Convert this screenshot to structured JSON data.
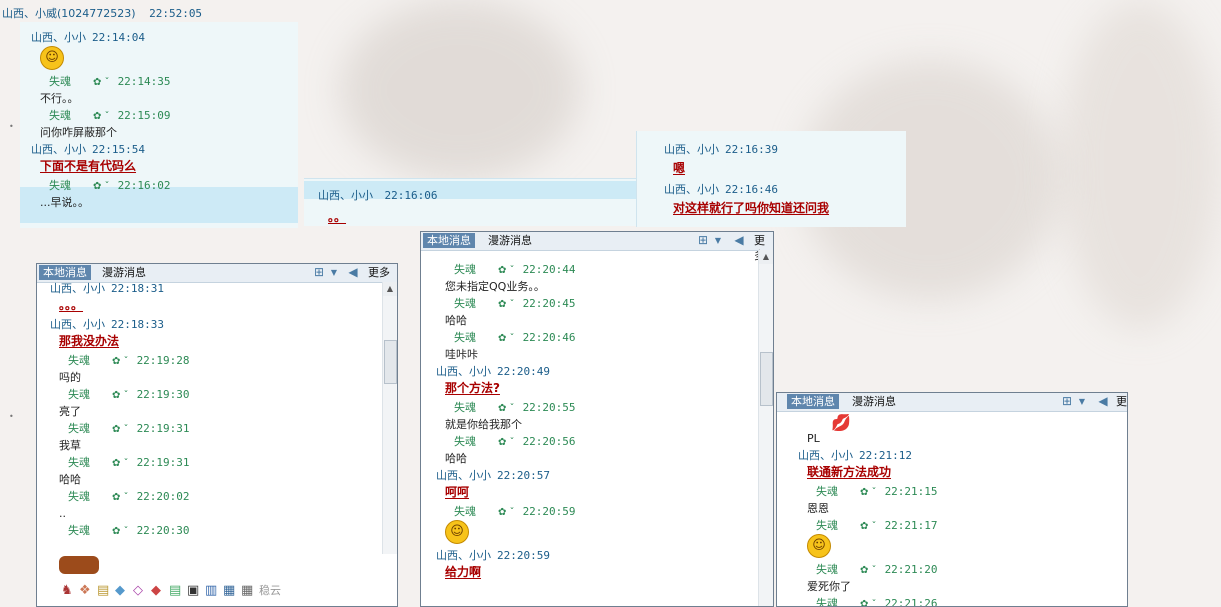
{
  "colors": {
    "name_blue": "#1b5d8a",
    "sender_green": "#2d8a55",
    "bold_red": "#a80000",
    "tab_active": "#5f86ad",
    "highlight": "#cdeaf6",
    "panel_bg": "#eef7f9"
  },
  "top_header": {
    "sender": "山西、小威(1024772523)",
    "time": "22:52:05"
  },
  "chat1": {
    "messages": [
      {
        "kind": "name",
        "text": "山西、小小",
        "time": "22:14:04"
      },
      {
        "kind": "emoji",
        "icon": "grin-emoji"
      },
      {
        "kind": "sender",
        "text": "失魂",
        "time": "22:14:35"
      },
      {
        "kind": "msg",
        "text": "不行。。"
      },
      {
        "kind": "sender",
        "text": "失魂",
        "time": "22:15:09"
      },
      {
        "kind": "msg",
        "text": "问你咋屏蔽那个"
      },
      {
        "kind": "name",
        "text": "山西、小小",
        "time": "22:15:54"
      },
      {
        "kind": "bold",
        "text": "下面不是有代码么"
      },
      {
        "kind": "sender",
        "text": "失魂",
        "time": "22:16:02"
      },
      {
        "kind": "msg",
        "text": "...早说。。"
      }
    ]
  },
  "chat2": {
    "name": "山西、小小",
    "time": "22:16:06",
    "bold": "。。"
  },
  "chat3": {
    "lines": [
      {
        "kind": "name",
        "text": "山西、小小",
        "time": "22:16:39"
      },
      {
        "kind": "bold",
        "text": "嗯"
      },
      {
        "kind": "name",
        "text": "山西、小小",
        "time": "22:16:46"
      },
      {
        "kind": "bold",
        "text": "对这样就行了吗你知道还问我"
      }
    ]
  },
  "window_a": {
    "tab_active": "本地消息",
    "tab": "漫游消息",
    "more": "更多",
    "lines": [
      {
        "kind": "name",
        "text": "山西、小小",
        "time": "22:18:31"
      },
      {
        "kind": "bold",
        "text": "。。。"
      },
      {
        "kind": "name",
        "text": "山西、小小",
        "time": "22:18:33"
      },
      {
        "kind": "bold",
        "text": "那我没办法"
      },
      {
        "kind": "sender",
        "text": "失魂",
        "time": "22:19:28"
      },
      {
        "kind": "msg",
        "text": "吗的"
      },
      {
        "kind": "sender",
        "text": "失魂",
        "time": "22:19:30"
      },
      {
        "kind": "msg",
        "text": "亮了"
      },
      {
        "kind": "sender",
        "text": "失魂",
        "time": "22:19:31"
      },
      {
        "kind": "msg",
        "text": "我草"
      },
      {
        "kind": "sender",
        "text": "失魂",
        "time": "22:19:31"
      },
      {
        "kind": "msg",
        "text": "哈哈"
      },
      {
        "kind": "sender",
        "text": "失魂",
        "time": "22:20:02"
      },
      {
        "kind": "msg",
        "text": ".."
      },
      {
        "kind": "sender",
        "text": "失魂",
        "time": "22:20:30"
      }
    ]
  },
  "window_b": {
    "tab_active": "本地消息",
    "tab": "漫游消息",
    "more": "更多",
    "lines": [
      {
        "kind": "sender",
        "text": "失魂",
        "time": "22:20:44"
      },
      {
        "kind": "msg",
        "text": "您未指定QQ业务。。"
      },
      {
        "kind": "sender",
        "text": "失魂",
        "time": "22:20:45"
      },
      {
        "kind": "msg",
        "text": "哈哈"
      },
      {
        "kind": "sender",
        "text": "失魂",
        "time": "22:20:46"
      },
      {
        "kind": "msg",
        "text": "哇咔咔"
      },
      {
        "kind": "name",
        "text": "山西、小小",
        "time": "22:20:49"
      },
      {
        "kind": "bold",
        "text": "那个方法?"
      },
      {
        "kind": "sender",
        "text": "失魂",
        "time": "22:20:55"
      },
      {
        "kind": "msg",
        "text": "就是你给我那个"
      },
      {
        "kind": "sender",
        "text": "失魂",
        "time": "22:20:56"
      },
      {
        "kind": "msg",
        "text": "哈哈"
      },
      {
        "kind": "name",
        "text": "山西、小小",
        "time": "22:20:57"
      },
      {
        "kind": "bold",
        "text": "呵呵"
      },
      {
        "kind": "sender",
        "text": "失魂",
        "time": "22:20:59"
      },
      {
        "kind": "emoji",
        "icon": "laugh-emoji"
      },
      {
        "kind": "name",
        "text": "山西、小小",
        "time": "22:20:59"
      },
      {
        "kind": "bold",
        "text": "给力啊"
      }
    ]
  },
  "window_c": {
    "tab_active": "本地消息",
    "tab": "漫游消息",
    "more": "更",
    "lines": [
      {
        "kind": "lips"
      },
      {
        "kind": "msg",
        "text": "PL"
      },
      {
        "kind": "name",
        "text": "山西、小小",
        "time": "22:21:12"
      },
      {
        "kind": "bold",
        "text": "联通新方法成功"
      },
      {
        "kind": "sender",
        "text": "失魂",
        "time": "22:21:15"
      },
      {
        "kind": "msg",
        "text": "恩恩"
      },
      {
        "kind": "sender",
        "text": "失魂",
        "time": "22:21:17"
      },
      {
        "kind": "emoji",
        "icon": "laugh-emoji"
      },
      {
        "kind": "sender",
        "text": "失魂",
        "time": "22:21:20"
      },
      {
        "kind": "msg",
        "text": "爱死你了"
      },
      {
        "kind": "sender",
        "text": "失魂",
        "time": "22:21:26"
      }
    ]
  },
  "toolbar_icons": [
    "qq-penguin-icon",
    "gift-icon",
    "card-icon",
    "gem-icon",
    "diamond-icon",
    "gem-icon",
    "card-icon",
    "lock-icon",
    "phone-icon",
    "disk-icon",
    "disk-icon"
  ],
  "toolbar_tail": "稳云"
}
